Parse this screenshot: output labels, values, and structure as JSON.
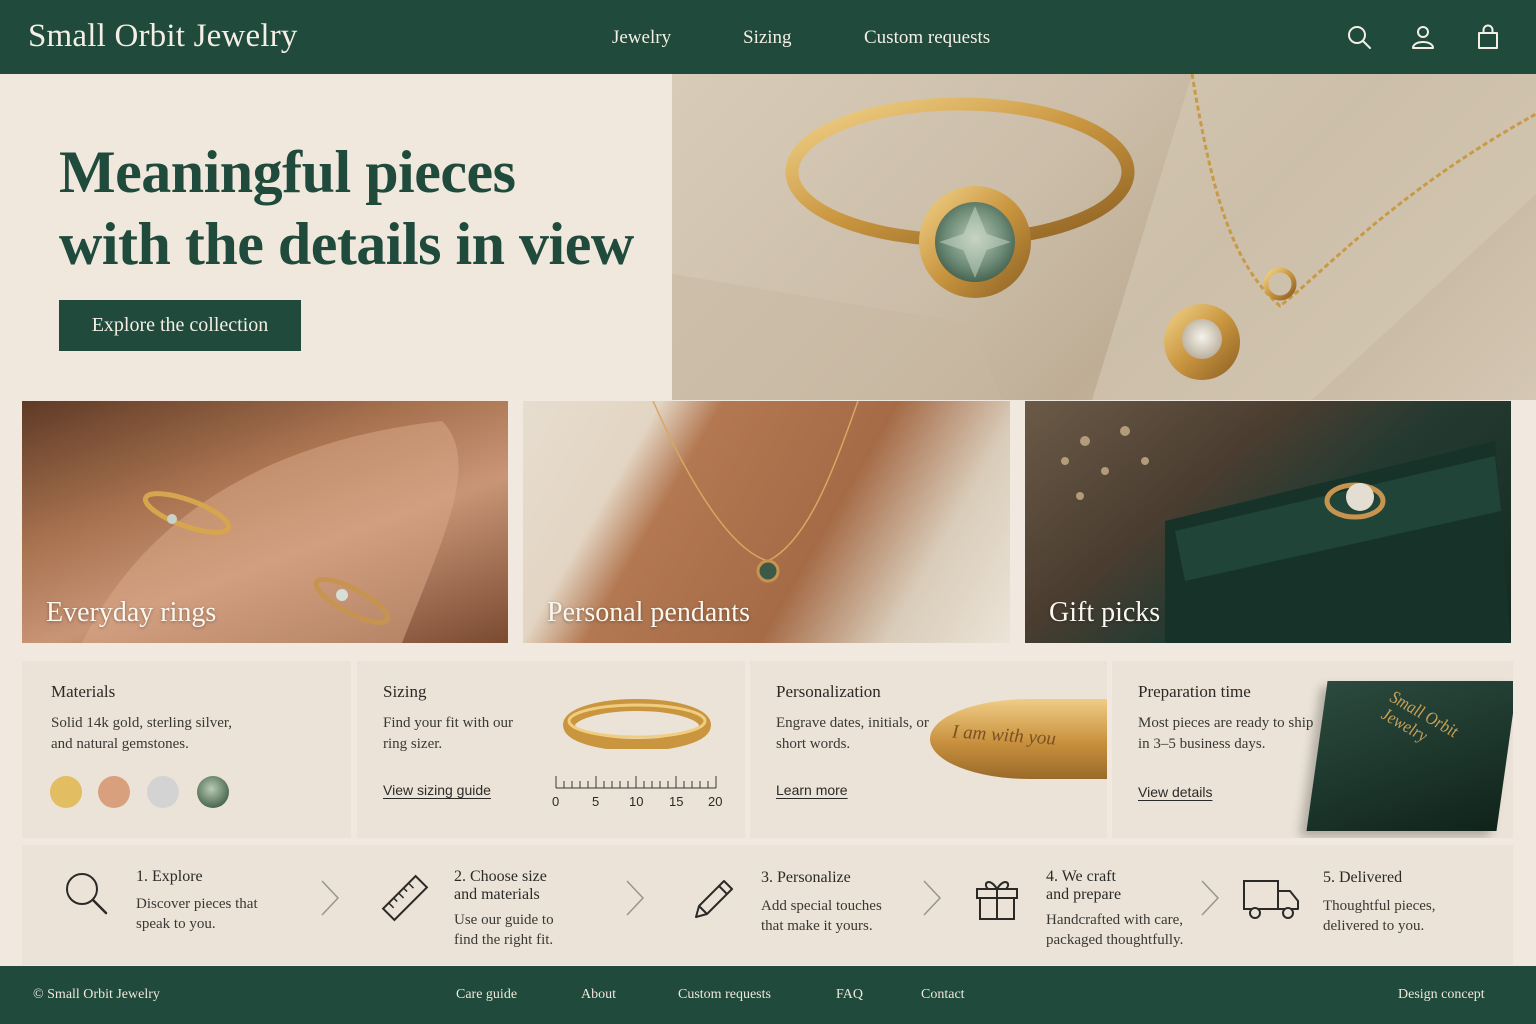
{
  "header": {
    "brand": "Small Orbit Jewelry",
    "nav": [
      "Jewelry",
      "Sizing",
      "Custom requests"
    ],
    "icons": [
      "search-icon",
      "account-icon",
      "bag-icon"
    ]
  },
  "hero": {
    "title_line1": "Meaningful pieces",
    "title_line2": "with the details in view",
    "cta": "Explore the collection",
    "image": "ring-and-pendant-photo"
  },
  "categories": [
    {
      "label": "Everyday rings"
    },
    {
      "label": "Personal pendants"
    },
    {
      "label": "Gift picks"
    }
  ],
  "info_cards": {
    "materials": {
      "title": "Materials",
      "desc_line1": "Solid 14k gold, sterling silver,",
      "desc_line2": "and natural gemstones.",
      "swatch_colors": [
        "#e2bd62",
        "#d9a07d",
        "#d3d3d3",
        "#4e6b52"
      ]
    },
    "sizing": {
      "title": "Sizing",
      "desc_line1": "Find your fit with our",
      "desc_line2": "ring sizer.",
      "link": "View sizing guide",
      "ruler_ticks": [
        "0",
        "5",
        "10",
        "15",
        "20"
      ]
    },
    "personalization": {
      "title": "Personalization",
      "desc_line1": "Engrave dates, initials, or",
      "desc_line2": "short words.",
      "link": "Learn more",
      "engraving": "I am with you"
    },
    "preparation": {
      "title": "Preparation time",
      "desc_line1": "Most pieces are ready to ship",
      "desc_line2": "in 3–5 business days.",
      "link": "View details",
      "box_text_line1": "Small Orbit",
      "box_text_line2": "Jewelry"
    }
  },
  "steps": [
    {
      "title_line1": "1. Explore",
      "title_line2": "",
      "desc_line1": "Discover pieces that",
      "desc_line2": "speak to you.",
      "icon": "search-icon"
    },
    {
      "title_line1": "2. Choose size",
      "title_line2": "and materials",
      "desc_line1": "Use our guide to",
      "desc_line2": "find the right fit.",
      "icon": "ruler-icon"
    },
    {
      "title_line1": "3. Personalize",
      "title_line2": "",
      "desc_line1": "Add special touches",
      "desc_line2": "that make it yours.",
      "icon": "pencil-icon"
    },
    {
      "title_line1": "4. We craft",
      "title_line2": "and prepare",
      "desc_line1": "Handcrafted with care,",
      "desc_line2": "packaged thoughtfully.",
      "icon": "gift-icon"
    },
    {
      "title_line1": "5. Delivered",
      "title_line2": "",
      "desc_line1": "Thoughtful pieces,",
      "desc_line2": "delivered to you.",
      "icon": "truck-icon"
    }
  ],
  "footer": {
    "copyright": "© Small Orbit Jewelry",
    "links": [
      "Care guide",
      "About",
      "Custom requests",
      "FAQ",
      "Contact"
    ],
    "note": "Design concept"
  }
}
